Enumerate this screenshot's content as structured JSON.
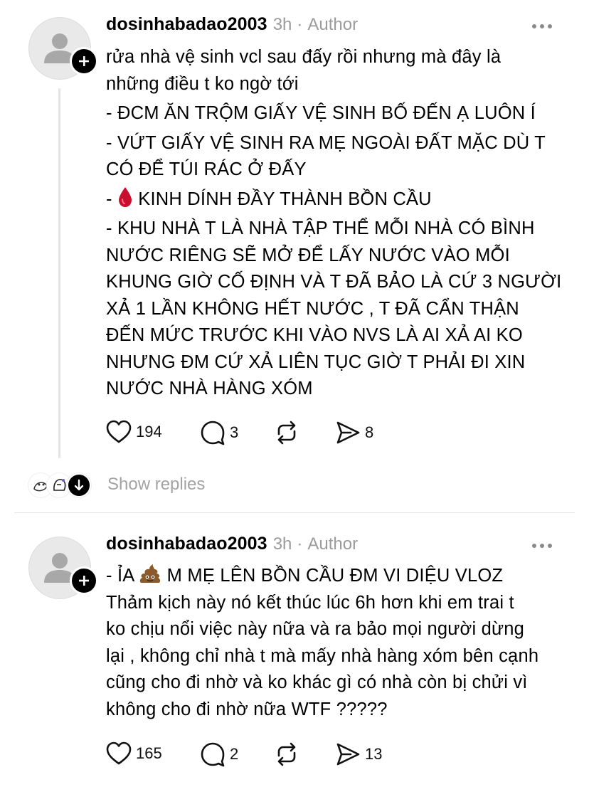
{
  "posts": [
    {
      "username": "dosinhabadao2003",
      "time": "3h",
      "separator": "·",
      "role": "Author",
      "paragraphs": [
        [
          "rửa nhà vệ sinh vcl sau đấy rồi nhưng mà đây là",
          "những điều t ko ngờ tới"
        ],
        [
          "- ĐCM ĂN TRỘM GIẤY VỆ SINH BỐ ĐẾN Ạ LUÔN Í"
        ],
        [
          "- VỨT GIẤY VỆ SINH RA MẸ NGOÀI ĐẤT MẶC DÙ T",
          "CÓ ĐỂ TÚI RÁC Ở ĐẤY"
        ],
        [
          "- ",
          "KINH DÍNH ĐẦY THÀNH BỒN CẦU"
        ],
        [
          "- KHU NHÀ T LÀ NHÀ TẬP THỂ MỖI NHÀ CÓ BÌNH",
          "NƯỚC RIÊNG SẼ MỞ ĐỂ LẤY NƯỚC VÀO MỖI",
          "KHUNG GIỜ CỐ ĐỊNH VÀ T ĐÃ BẢO LÀ CỨ 3 NGƯỜI",
          "XẢ 1 LẦN KHÔNG HẾT NƯỚC , T ĐÃ CẨN THẬN",
          "ĐẾN MỨC TRƯỚC KHI VÀO NVS LÀ AI XẢ AI KO",
          "NHƯNG ĐM CỨ XẢ LIÊN TỤC GIỜ T PHẢI ĐI XIN",
          "NƯỚC NHÀ HÀNG XÓM"
        ]
      ],
      "likes": "194",
      "replies": "3",
      "reposts": "",
      "shares": "8"
    },
    {
      "username": "dosinhabadao2003",
      "time": "3h",
      "separator": "·",
      "role": "Author",
      "line1_prefix": "- ỈA",
      "line1_suffix": "M MẸ LÊN BỒN CẦU ĐM VI DIỆU VLOZ",
      "lines": [
        "Thảm kịch này nó kết thúc lúc 6h hơn khi em trai t",
        "ko chịu nổi việc này nữa và ra bảo mọi người dừng",
        "lại , không chỉ nhà t mà mấy nhà hàng xóm bên cạnh",
        "cũng cho đi nhờ và ko khác gì có nhà còn bị chửi vì",
        "không cho đi nhờ nữa WTF ?????"
      ],
      "likes": "165",
      "replies": "2",
      "reposts": "",
      "shares": "13"
    }
  ],
  "show_replies_label": "Show replies",
  "icons": [
    "heart-icon",
    "comment-icon",
    "repost-icon",
    "share-icon",
    "more-icon",
    "plus-icon",
    "blood-drop-icon",
    "poop-icon",
    "chevron-down-icon"
  ],
  "colors": {
    "meta_gray": "#9b9b9b",
    "show_replies_gray": "#a3a3a3",
    "thread_line": "#e3e3e3"
  }
}
